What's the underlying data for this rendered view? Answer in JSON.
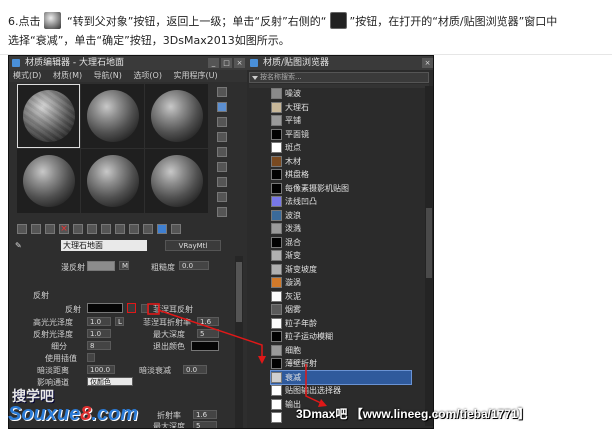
{
  "instructions": {
    "line1_a": "6.点击",
    "line1_b": " “转到父对象”按钮，返回上一级；单击“反射”右侧的“",
    "line1_c": "”按钮，在打开的“材质/贴图浏览器”窗口中",
    "line2": "选择“衰减”，单击“确定”按钮，3DsMax2013如图所示。"
  },
  "material_editor": {
    "title": "材质编辑器 - 大理石地面",
    "menu": [
      "模式(D)",
      "材质(M)",
      "导航(N)",
      "选项(O)",
      "实用程序(U)"
    ],
    "material_name": "大理石地面",
    "type_button": "VRayMtl",
    "diffuse_label": "漫反射",
    "roughness_label": "粗糙度",
    "roughness_value": "0.0",
    "m_button": "M",
    "reflection_section": "反射",
    "reflect_label": "反射",
    "refl_rows": [
      {
        "label": "高光光泽度",
        "value": "1.0",
        "btn": "L"
      },
      {
        "label": "反射光泽度",
        "value": "1.0"
      },
      {
        "label": "细分",
        "value": "8"
      },
      {
        "label": "使用插值",
        "value": ""
      },
      {
        "label": "暗淡距离",
        "value": "100.0"
      },
      {
        "label": "影响通道",
        "value": "仅颜色"
      }
    ],
    "right_rows": [
      {
        "label": "菲涅耳反射",
        "value": ""
      },
      {
        "label": "菲涅耳折射率",
        "value": "1.6"
      },
      {
        "label": "最大深度",
        "value": "5"
      },
      {
        "label": "退出颜色",
        "value": ""
      },
      {
        "label": "暗淡衰减",
        "value": "0.0"
      }
    ],
    "refraction_labels": {
      "ior": "折射率",
      "max_depth": "最大深度",
      "ior_value": "1.6",
      "depth_value": "5"
    }
  },
  "browser": {
    "title": "材质/贴图浏览器",
    "search_placeholder": "按名称搜索...",
    "items": [
      {
        "label": "噪波",
        "icon": "noise-icon",
        "color": "#8a8a8a"
      },
      {
        "label": "大理石",
        "icon": "marble-icon",
        "color": "#c8b89a"
      },
      {
        "label": "平铺",
        "icon": "tiles-icon",
        "color": "#9a9a9a"
      },
      {
        "label": "平面镜",
        "icon": "flat-mirror-icon",
        "color": "#000000"
      },
      {
        "label": "斑点",
        "icon": "speckle-icon",
        "color": "#ffffff"
      },
      {
        "label": "木材",
        "icon": "wood-icon",
        "color": "#7a4a20"
      },
      {
        "label": "棋盘格",
        "icon": "checker-icon",
        "color": "#000000"
      },
      {
        "label": "每像素摄影机贴图",
        "icon": "camera-map-icon",
        "color": "#000000"
      },
      {
        "label": "法线凹凸",
        "icon": "normal-bump-icon",
        "color": "#7878e8"
      },
      {
        "label": "波浪",
        "icon": "waves-icon",
        "color": "#3a6a9a"
      },
      {
        "label": "泼溅",
        "icon": "splat-icon",
        "color": "#9a9a9a"
      },
      {
        "label": "混合",
        "icon": "mix-icon",
        "color": "#000000"
      },
      {
        "label": "渐变",
        "icon": "gradient-icon",
        "color": "#b0b0b0"
      },
      {
        "label": "渐变坡度",
        "icon": "gradient-ramp-icon",
        "color": "#b0b0b0"
      },
      {
        "label": "漩涡",
        "icon": "swirl-icon",
        "color": "#d27a2a"
      },
      {
        "label": "灰泥",
        "icon": "stucco-icon",
        "color": "#ffffff"
      },
      {
        "label": "烟雾",
        "icon": "smoke-icon",
        "color": "#5a5a5a"
      },
      {
        "label": "粒子年龄",
        "icon": "particle-age-icon",
        "color": "#ffffff"
      },
      {
        "label": "粒子运动模糊",
        "icon": "particle-mblur-icon",
        "color": "#000000"
      },
      {
        "label": "细胞",
        "icon": "cellular-icon",
        "color": "#9a9a9a"
      },
      {
        "label": "薄壁折射",
        "icon": "thin-wall-icon",
        "color": "#000000"
      },
      {
        "label": "衰减",
        "icon": "falloff-icon",
        "color": "#cfcfcf",
        "selected": true
      },
      {
        "label": "贴图输出选择器",
        "icon": "output-selector-icon",
        "color": "#ffffff"
      },
      {
        "label": "输出",
        "icon": "output-icon",
        "color": "#ffffff"
      },
      {
        "label": "",
        "icon": "blank-icon",
        "color": "#ffffff"
      }
    ]
  },
  "watermarks": {
    "site_cn": "搜学吧",
    "site_en_a": "Souxue",
    "site_en_b": "8",
    "site_en_c": ".com",
    "bar_a": "3Dmax吧 【",
    "bar_url": "www.lineeg.com/tieba/1771",
    "bar_b": "】"
  },
  "colors": {
    "annotation_red": "#e01818",
    "selection_blue": "#2f5a9c"
  }
}
